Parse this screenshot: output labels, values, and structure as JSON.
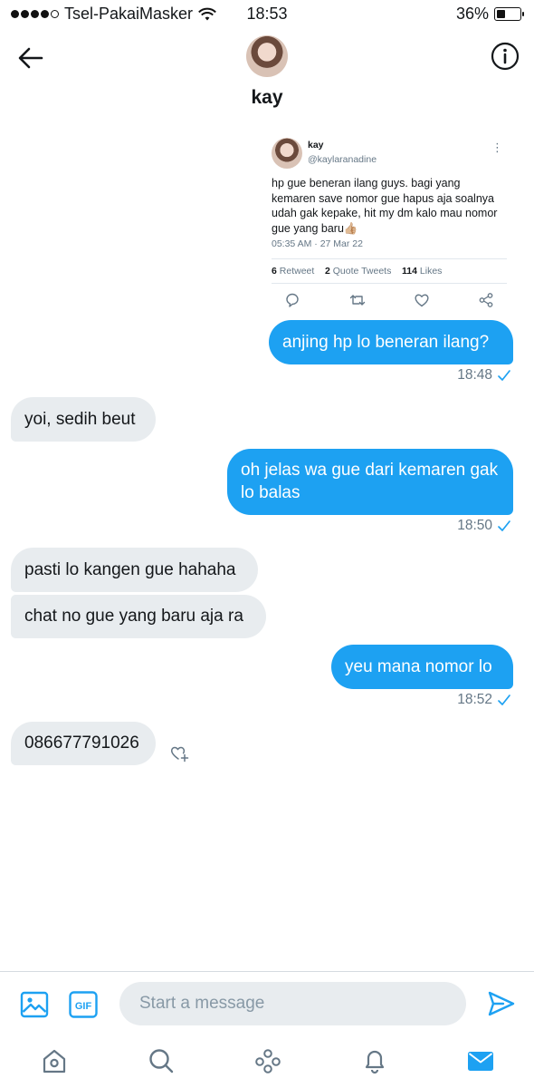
{
  "status_bar": {
    "carrier": "Tsel-PakaiMasker",
    "time": "18:53",
    "battery": "36%",
    "battery_level": 0.36
  },
  "header": {
    "contact_name": "kay",
    "back_icon": "arrow-left-icon",
    "info_icon": "info-icon"
  },
  "tweet": {
    "name": "kay",
    "handle": "@kaylaranadine",
    "text": "hp gue beneran ilang guys. bagi yang kemaren save nomor gue hapus aja soalnya udah gak kepake, hit my dm kalo mau nomor gue yang baru👍🏼",
    "date": "05:35 AM · 27 Mar 22",
    "retweets": "6",
    "retweets_label": "Retweet",
    "quotes": "2",
    "quotes_label": "Quote Tweets",
    "likes": "114",
    "likes_label": "Likes"
  },
  "messages": [
    {
      "text": "anjing hp lo beneran ilang?",
      "direction": "out"
    },
    {
      "text": "18:48",
      "type": "time"
    },
    {
      "text": "yoi, sedih beut",
      "direction": "in"
    },
    {
      "text": "oh jelas wa gue dari kemaren gak lo balas",
      "direction": "out"
    },
    {
      "text": "18:50",
      "type": "time"
    },
    {
      "text": "pasti lo kangen gue hahaha",
      "direction": "in"
    },
    {
      "text": "chat no gue yang baru aja ra",
      "direction": "in"
    },
    {
      "text": "yeu mana nomor lo",
      "direction": "out"
    },
    {
      "text": "18:52",
      "type": "time"
    },
    {
      "text": "086677791026",
      "direction": "in"
    }
  ],
  "composer": {
    "placeholder": "Start a message",
    "value": "",
    "gif_label": "GIF"
  },
  "tabs": [
    "home-icon",
    "search-icon",
    "spaces-icon",
    "notifications-icon",
    "messages-icon"
  ],
  "colors": {
    "accent": "#1da1f2",
    "incoming_bubble": "#e8ecef",
    "muted_text": "#657786"
  }
}
